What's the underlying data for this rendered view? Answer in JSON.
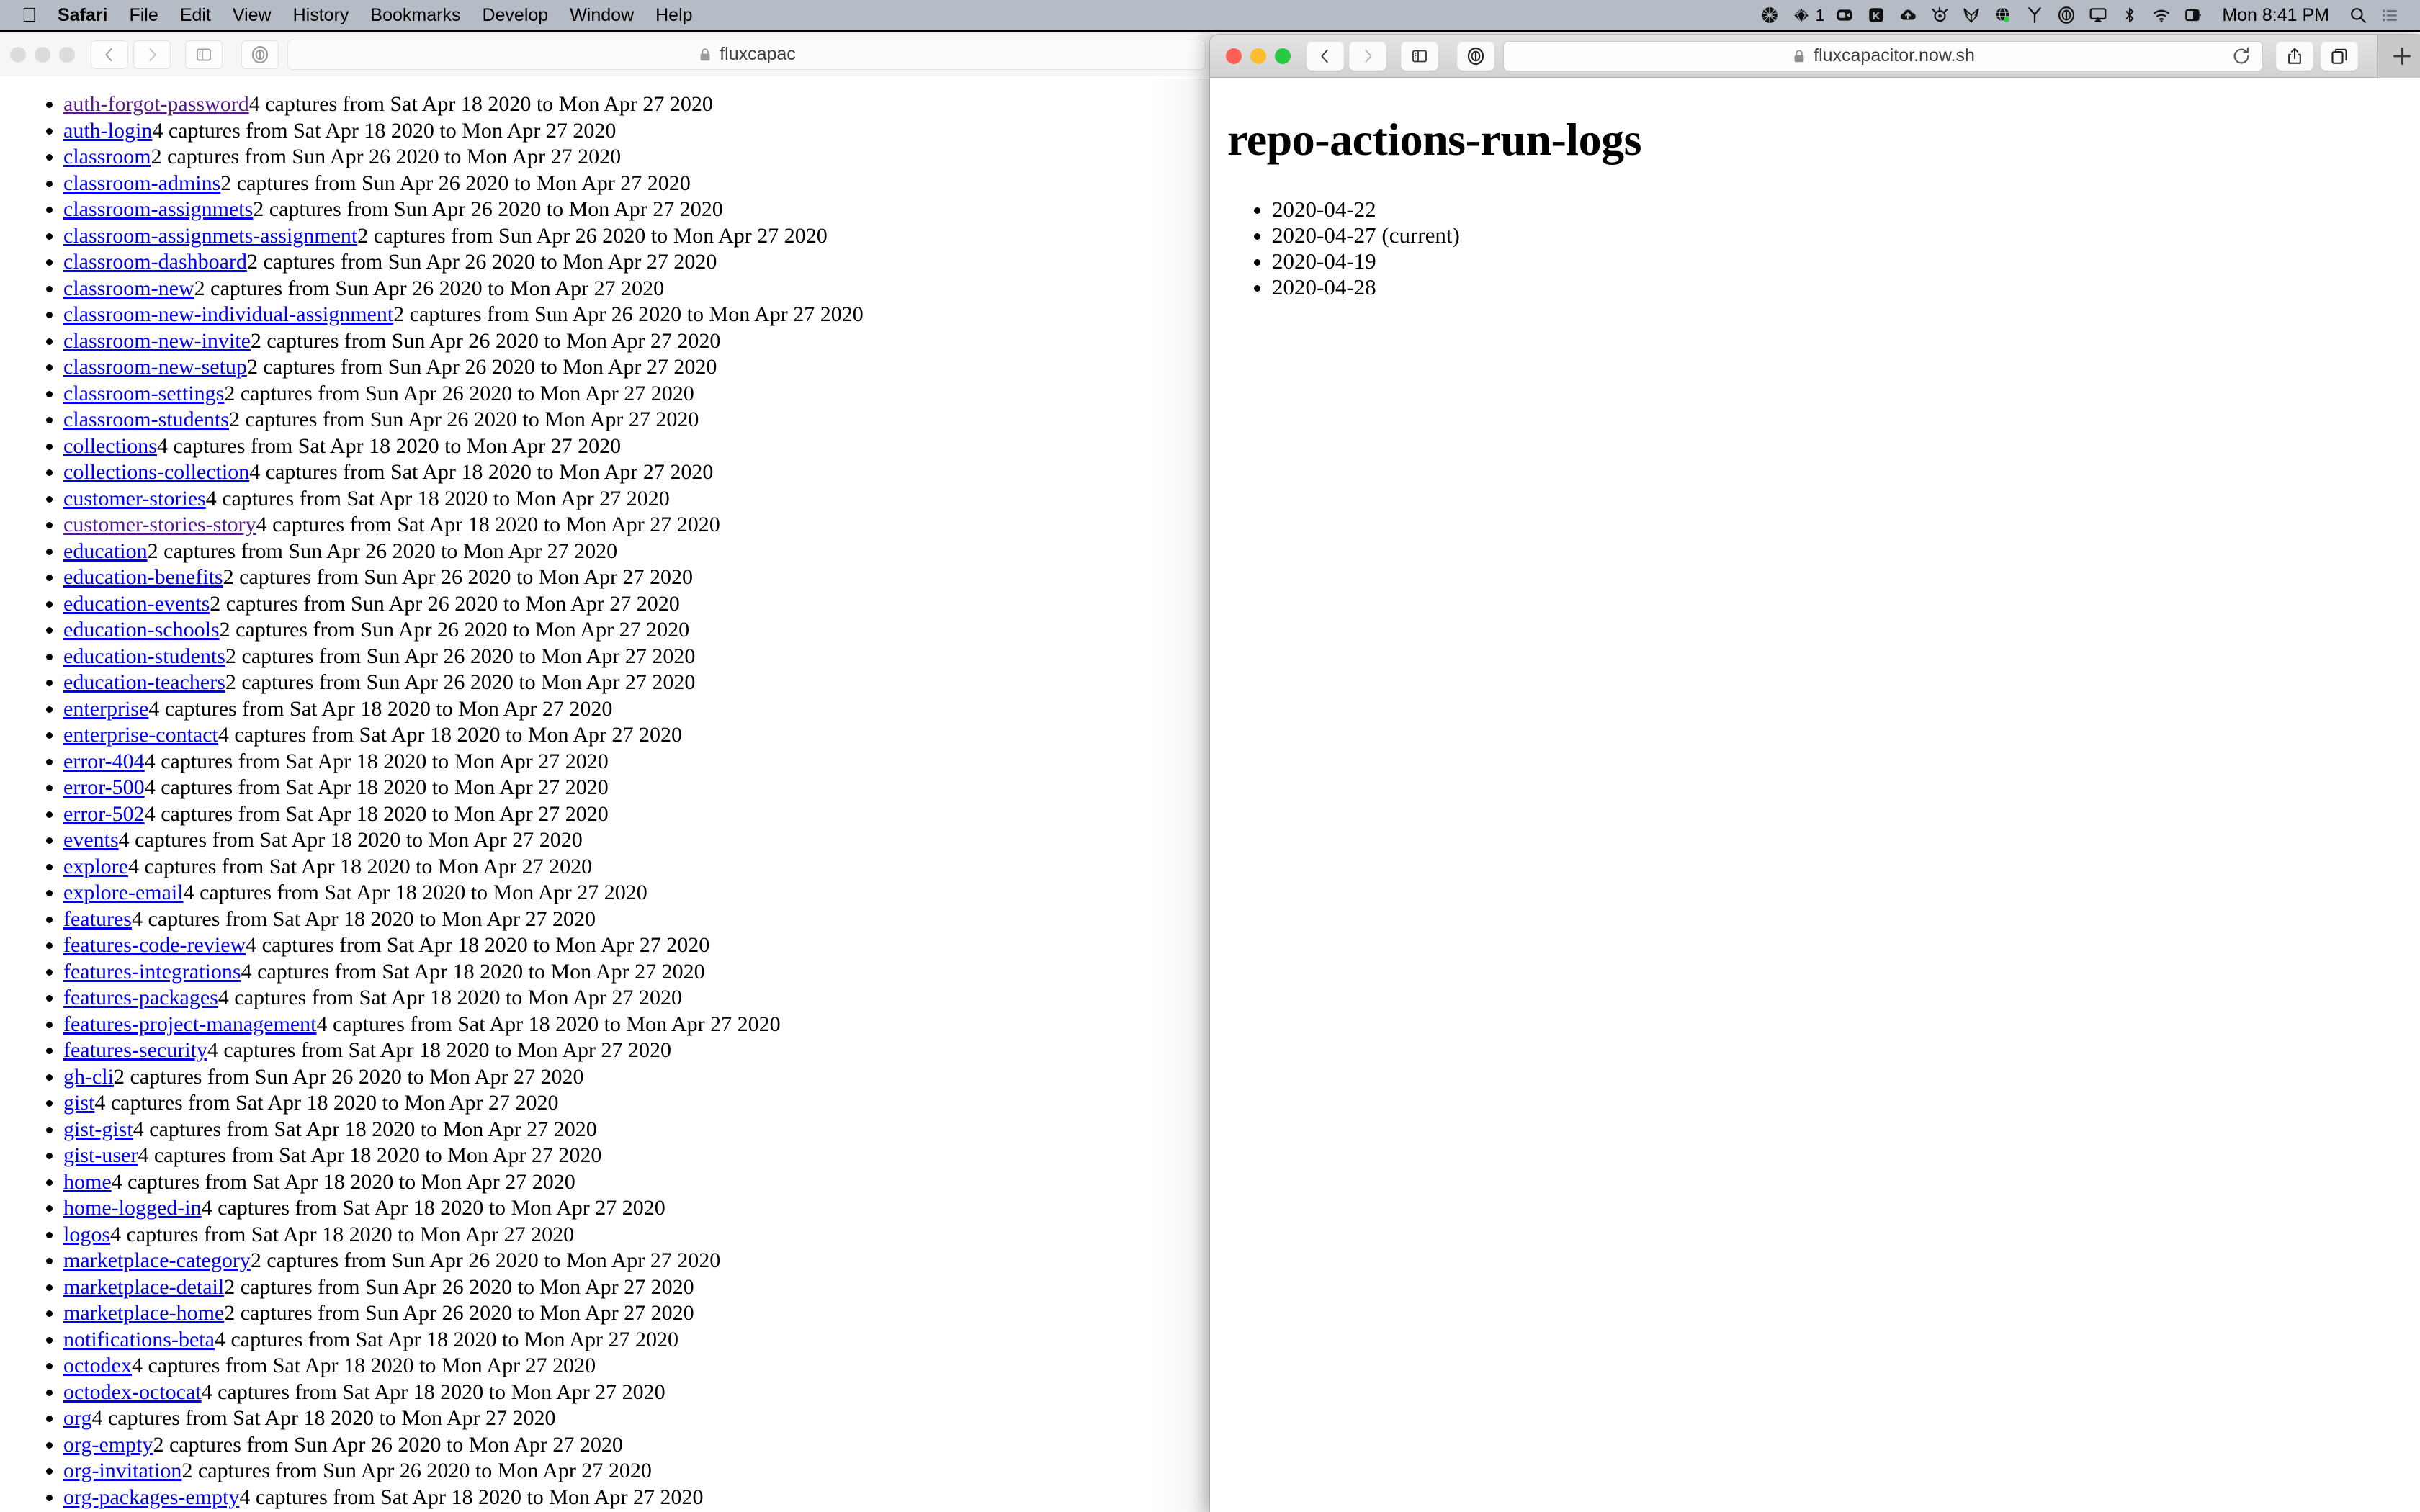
{
  "menubar": {
    "apple_logo": "apple-logo",
    "items": [
      {
        "label": "Safari",
        "bold": true
      },
      {
        "label": "File",
        "bold": false
      },
      {
        "label": "Edit",
        "bold": false
      },
      {
        "label": "View",
        "bold": false
      },
      {
        "label": "History",
        "bold": false
      },
      {
        "label": "Bookmarks",
        "bold": false
      },
      {
        "label": "Develop",
        "bold": false
      },
      {
        "label": "Window",
        "bold": false
      },
      {
        "label": "Help",
        "bold": false
      }
    ],
    "status_icons": [
      {
        "name": "mesh-network-icon"
      },
      {
        "name": "diamond-cluster-icon",
        "badge": "1"
      },
      {
        "name": "video-camera-icon"
      },
      {
        "name": "k-app-icon"
      },
      {
        "name": "cloud-upload-icon"
      },
      {
        "name": "steelseries-icon"
      },
      {
        "name": "fox-outline-icon"
      },
      {
        "name": "globe-status-icon"
      },
      {
        "name": "branch-icon"
      },
      {
        "name": "onepassword-icon"
      },
      {
        "name": "airplay-icon"
      },
      {
        "name": "bluetooth-icon"
      },
      {
        "name": "wifi-icon"
      },
      {
        "name": "display-toggle-icon"
      }
    ],
    "clock": "Mon 8:41 PM",
    "search_icon": "search-icon",
    "control_center_icon": "control-center-icon"
  },
  "background_window": {
    "traffic_lights": [
      "close",
      "minimize",
      "zoom"
    ],
    "back_label": "back-icon",
    "forward_label": "forward-icon",
    "sidebar_label": "sidebar-icon",
    "onepassword_label": "onepassword-icon",
    "url": "fluxcapac",
    "lock": "lock-icon",
    "captures": [
      {
        "name": "auth-forgot-password",
        "visited": true,
        "text": "4 captures from Sat Apr 18 2020 to Mon Apr 27 2020"
      },
      {
        "name": "auth-login",
        "visited": false,
        "text": "4 captures from Sat Apr 18 2020 to Mon Apr 27 2020"
      },
      {
        "name": "classroom",
        "visited": false,
        "text": "2 captures from Sun Apr 26 2020 to Mon Apr 27 2020"
      },
      {
        "name": "classroom-admins",
        "visited": false,
        "text": "2 captures from Sun Apr 26 2020 to Mon Apr 27 2020"
      },
      {
        "name": "classroom-assignmets",
        "visited": false,
        "text": "2 captures from Sun Apr 26 2020 to Mon Apr 27 2020"
      },
      {
        "name": "classroom-assignmets-assignment",
        "visited": false,
        "text": "2 captures from Sun Apr 26 2020 to Mon Apr 27 2020"
      },
      {
        "name": "classroom-dashboard",
        "visited": false,
        "text": "2 captures from Sun Apr 26 2020 to Mon Apr 27 2020"
      },
      {
        "name": "classroom-new",
        "visited": false,
        "text": "2 captures from Sun Apr 26 2020 to Mon Apr 27 2020"
      },
      {
        "name": "classroom-new-individual-assignment",
        "visited": false,
        "text": "2 captures from Sun Apr 26 2020 to Mon Apr 27 2020"
      },
      {
        "name": "classroom-new-invite",
        "visited": false,
        "text": "2 captures from Sun Apr 26 2020 to Mon Apr 27 2020"
      },
      {
        "name": "classroom-new-setup",
        "visited": false,
        "text": "2 captures from Sun Apr 26 2020 to Mon Apr 27 2020"
      },
      {
        "name": "classroom-settings",
        "visited": false,
        "text": "2 captures from Sun Apr 26 2020 to Mon Apr 27 2020"
      },
      {
        "name": "classroom-students",
        "visited": false,
        "text": "2 captures from Sun Apr 26 2020 to Mon Apr 27 2020"
      },
      {
        "name": "collections",
        "visited": false,
        "text": "4 captures from Sat Apr 18 2020 to Mon Apr 27 2020"
      },
      {
        "name": "collections-collection",
        "visited": false,
        "text": "4 captures from Sat Apr 18 2020 to Mon Apr 27 2020"
      },
      {
        "name": "customer-stories",
        "visited": false,
        "text": "4 captures from Sat Apr 18 2020 to Mon Apr 27 2020"
      },
      {
        "name": "customer-stories-story",
        "visited": true,
        "text": "4 captures from Sat Apr 18 2020 to Mon Apr 27 2020"
      },
      {
        "name": "education",
        "visited": false,
        "text": "2 captures from Sun Apr 26 2020 to Mon Apr 27 2020"
      },
      {
        "name": "education-benefits",
        "visited": false,
        "text": "2 captures from Sun Apr 26 2020 to Mon Apr 27 2020"
      },
      {
        "name": "education-events",
        "visited": false,
        "text": "2 captures from Sun Apr 26 2020 to Mon Apr 27 2020"
      },
      {
        "name": "education-schools",
        "visited": false,
        "text": "2 captures from Sun Apr 26 2020 to Mon Apr 27 2020"
      },
      {
        "name": "education-students",
        "visited": false,
        "text": "2 captures from Sun Apr 26 2020 to Mon Apr 27 2020"
      },
      {
        "name": "education-teachers",
        "visited": false,
        "text": "2 captures from Sun Apr 26 2020 to Mon Apr 27 2020"
      },
      {
        "name": "enterprise",
        "visited": false,
        "text": "4 captures from Sat Apr 18 2020 to Mon Apr 27 2020"
      },
      {
        "name": "enterprise-contact",
        "visited": false,
        "text": "4 captures from Sat Apr 18 2020 to Mon Apr 27 2020"
      },
      {
        "name": "error-404",
        "visited": false,
        "text": "4 captures from Sat Apr 18 2020 to Mon Apr 27 2020"
      },
      {
        "name": "error-500",
        "visited": false,
        "text": "4 captures from Sat Apr 18 2020 to Mon Apr 27 2020"
      },
      {
        "name": "error-502",
        "visited": false,
        "text": "4 captures from Sat Apr 18 2020 to Mon Apr 27 2020"
      },
      {
        "name": "events",
        "visited": false,
        "text": "4 captures from Sat Apr 18 2020 to Mon Apr 27 2020"
      },
      {
        "name": "explore",
        "visited": false,
        "text": "4 captures from Sat Apr 18 2020 to Mon Apr 27 2020"
      },
      {
        "name": "explore-email",
        "visited": false,
        "text": "4 captures from Sat Apr 18 2020 to Mon Apr 27 2020"
      },
      {
        "name": "features",
        "visited": false,
        "text": "4 captures from Sat Apr 18 2020 to Mon Apr 27 2020"
      },
      {
        "name": "features-code-review",
        "visited": false,
        "text": "4 captures from Sat Apr 18 2020 to Mon Apr 27 2020"
      },
      {
        "name": "features-integrations",
        "visited": false,
        "text": "4 captures from Sat Apr 18 2020 to Mon Apr 27 2020"
      },
      {
        "name": "features-packages",
        "visited": false,
        "text": "4 captures from Sat Apr 18 2020 to Mon Apr 27 2020"
      },
      {
        "name": "features-project-management",
        "visited": false,
        "text": "4 captures from Sat Apr 18 2020 to Mon Apr 27 2020"
      },
      {
        "name": "features-security",
        "visited": false,
        "text": "4 captures from Sat Apr 18 2020 to Mon Apr 27 2020"
      },
      {
        "name": "gh-cli",
        "visited": false,
        "text": "2 captures from Sun Apr 26 2020 to Mon Apr 27 2020"
      },
      {
        "name": "gist",
        "visited": false,
        "text": "4 captures from Sat Apr 18 2020 to Mon Apr 27 2020"
      },
      {
        "name": "gist-gist",
        "visited": false,
        "text": "4 captures from Sat Apr 18 2020 to Mon Apr 27 2020"
      },
      {
        "name": "gist-user",
        "visited": false,
        "text": "4 captures from Sat Apr 18 2020 to Mon Apr 27 2020"
      },
      {
        "name": "home",
        "visited": false,
        "text": "4 captures from Sat Apr 18 2020 to Mon Apr 27 2020"
      },
      {
        "name": "home-logged-in",
        "visited": false,
        "text": "4 captures from Sat Apr 18 2020 to Mon Apr 27 2020"
      },
      {
        "name": "logos",
        "visited": false,
        "text": "4 captures from Sat Apr 18 2020 to Mon Apr 27 2020"
      },
      {
        "name": "marketplace-category",
        "visited": false,
        "text": "2 captures from Sun Apr 26 2020 to Mon Apr 27 2020"
      },
      {
        "name": "marketplace-detail",
        "visited": false,
        "text": "2 captures from Sun Apr 26 2020 to Mon Apr 27 2020"
      },
      {
        "name": "marketplace-home",
        "visited": false,
        "text": "2 captures from Sun Apr 26 2020 to Mon Apr 27 2020"
      },
      {
        "name": "notifications-beta",
        "visited": false,
        "text": "4 captures from Sat Apr 18 2020 to Mon Apr 27 2020"
      },
      {
        "name": "octodex",
        "visited": false,
        "text": "4 captures from Sat Apr 18 2020 to Mon Apr 27 2020"
      },
      {
        "name": "octodex-octocat",
        "visited": false,
        "text": "4 captures from Sat Apr 18 2020 to Mon Apr 27 2020"
      },
      {
        "name": "org",
        "visited": false,
        "text": "4 captures from Sat Apr 18 2020 to Mon Apr 27 2020"
      },
      {
        "name": "org-empty",
        "visited": false,
        "text": "2 captures from Sun Apr 26 2020 to Mon Apr 27 2020"
      },
      {
        "name": "org-invitation",
        "visited": false,
        "text": "2 captures from Sun Apr 26 2020 to Mon Apr 27 2020"
      },
      {
        "name": "org-packages-empty",
        "visited": false,
        "text": "4 captures from Sat Apr 18 2020 to Mon Apr 27 2020"
      }
    ]
  },
  "foreground_window": {
    "traffic_lights": [
      "close",
      "minimize",
      "zoom"
    ],
    "back_label": "back-icon",
    "forward_label": "forward-icon",
    "sidebar_label": "sidebar-icon",
    "onepassword_label": "onepassword-icon",
    "url": "fluxcapacitor.now.sh",
    "lock": "lock-icon",
    "reload": "reload-icon",
    "share": "share-icon",
    "tabs_overview": "tabs-icon",
    "new_tab": "+",
    "page": {
      "title": "repo-actions-run-logs",
      "dates": [
        "2020-04-22",
        "2020-04-27 (current)",
        "2020-04-19",
        "2020-04-28"
      ]
    }
  },
  "colors": {
    "menubar_bg": "#b6bcc6",
    "link": "#0000ee",
    "visited_link": "#551a8b",
    "traffic_red": "#ff5f57",
    "traffic_yellow": "#febc2e",
    "traffic_green": "#28c840"
  }
}
